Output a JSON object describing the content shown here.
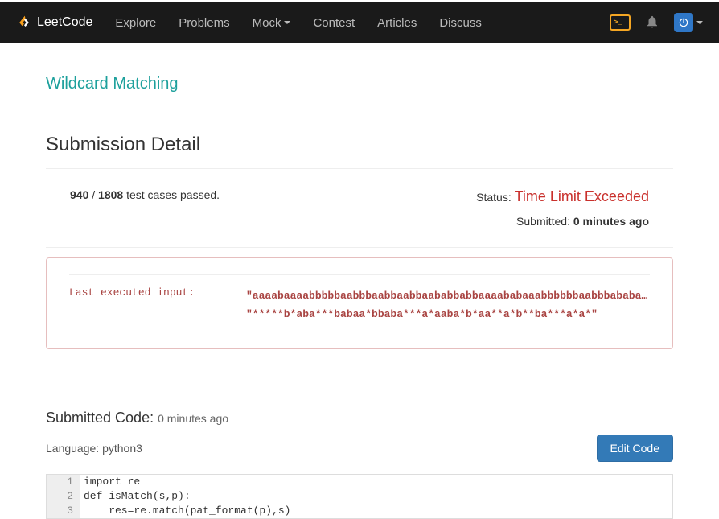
{
  "nav": {
    "brand": "LeetCode",
    "items": [
      "Explore",
      "Problems",
      "Mock",
      "Contest",
      "Articles",
      "Discuss"
    ]
  },
  "problem": {
    "title": "Wildcard Matching"
  },
  "section_title": "Submission Detail",
  "status": {
    "passed": "940",
    "total": "1808",
    "passed_suffix": " test cases passed.",
    "status_label": "Status: ",
    "status_value": "Time Limit Exceeded",
    "submitted_label": "Submitted: ",
    "submitted_value": "0 minutes ago"
  },
  "error": {
    "label": "Last executed input:",
    "line1": "\"aaaabaaaabbbbbaabbbaabbaabbaababbabbaaaababaaabbbbbbaabbbababab…",
    "line2": "\"*****b*aba***babaa*bbaba***a*aaba*b*aa**a*b**ba***a*a*\""
  },
  "submitted_code": {
    "title": "Submitted Code: ",
    "ago": "0 minutes ago",
    "language_label": "Language: ",
    "language": "python3",
    "edit_btn": "Edit Code",
    "lines": [
      "import re",
      "def isMatch(s,p):",
      "    res=re.match(pat_format(p),s)"
    ]
  }
}
